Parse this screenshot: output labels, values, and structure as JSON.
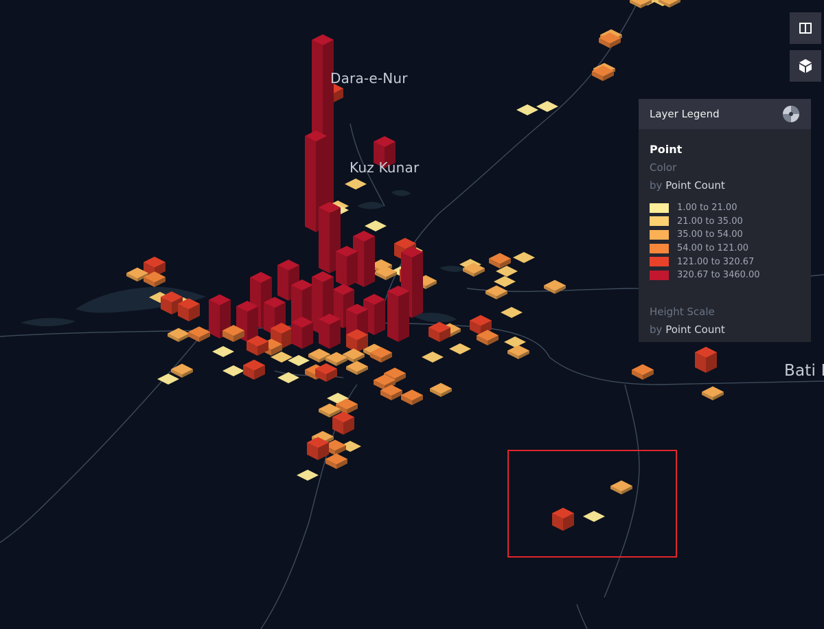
{
  "places": [
    {
      "name": "Dara-e-Nur"
    },
    {
      "name": "Kuz Kunar"
    },
    {
      "name": "Bati K"
    }
  ],
  "controls": {
    "split_map_icon": "split-map-icon",
    "3d_view_icon": "cube-3d-icon"
  },
  "legend": {
    "title": "Layer Legend",
    "layer_name": "Point",
    "color_label": "Color",
    "by_word": "by",
    "color_field": "Point Count",
    "height_label": "Height Scale",
    "height_field": "Point Count",
    "ranges": [
      {
        "label": "1.00 to 21.00",
        "color": "#ffee99"
      },
      {
        "label": "21.00 to 35.00",
        "color": "#fdd072"
      },
      {
        "label": "35.00 to 54.00",
        "color": "#fcb055"
      },
      {
        "label": "54.00 to 121.00",
        "color": "#f7873b"
      },
      {
        "label": "121.00 to 320.67",
        "color": "#e8422a"
      },
      {
        "label": "320.67 to 3460.00",
        "color": "#c2172f"
      }
    ]
  }
}
